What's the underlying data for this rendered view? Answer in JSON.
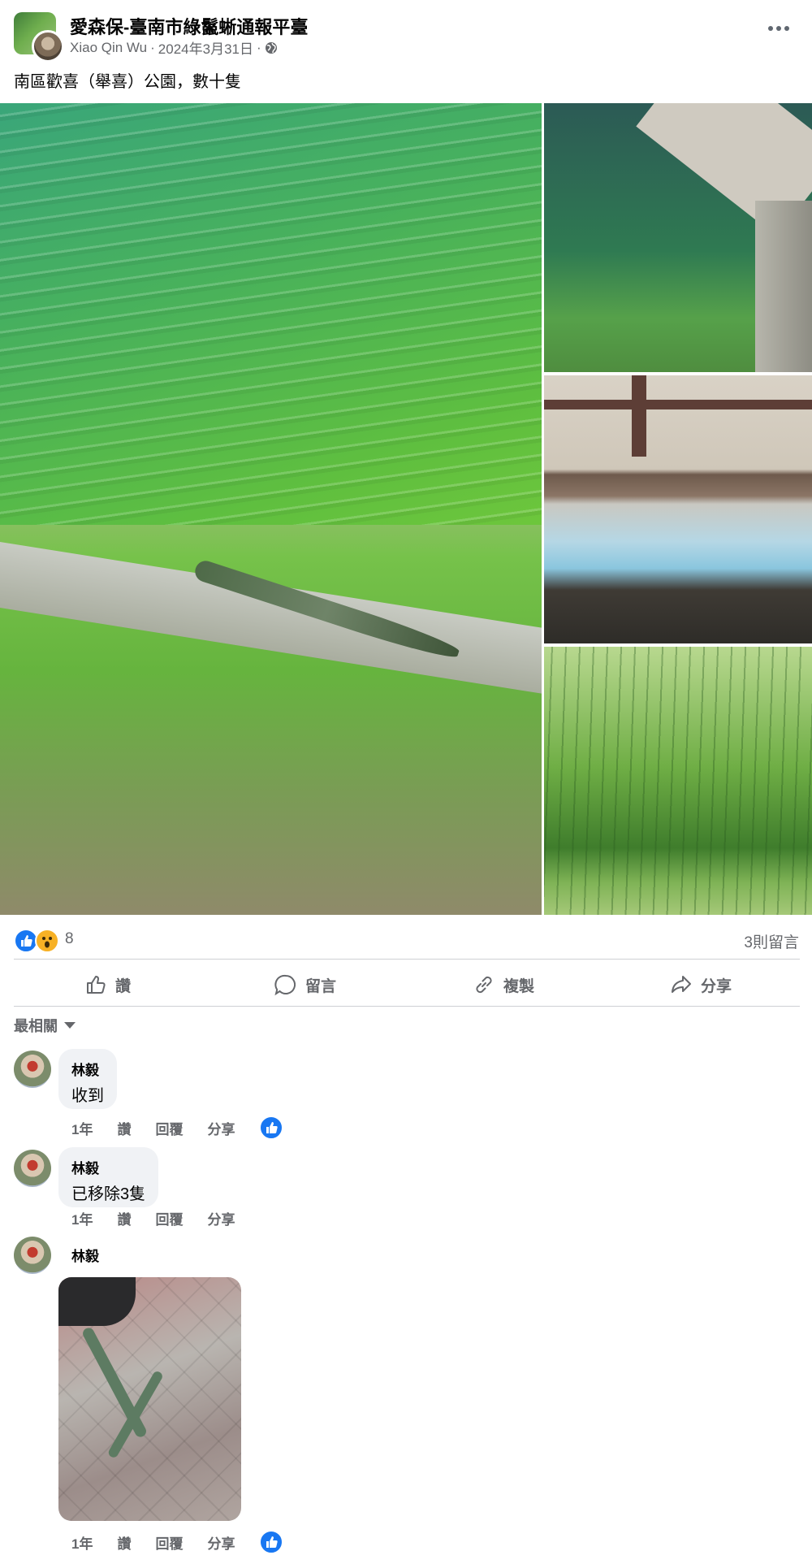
{
  "post": {
    "group_name": "愛森保-臺南市綠鬣蜥通報平臺",
    "author": "Xiao Qin Wu",
    "separator": "·",
    "date": "2024年3月31日",
    "audience_icon": "globe-icon",
    "text": "南區歡喜（舉喜）公園，數十隻"
  },
  "reactions": {
    "icons": [
      "like-icon",
      "wow-icon"
    ],
    "count": "8",
    "comments_count": "3則留言"
  },
  "actions": {
    "like": "讚",
    "comment": "留言",
    "copy": "複製",
    "share": "分享"
  },
  "sort": {
    "label": "最相關"
  },
  "comments": [
    {
      "name": "林毅",
      "text": "收到",
      "time": "1年",
      "like": "讚",
      "reply": "回覆",
      "share": "分享"
    },
    {
      "name": "林毅",
      "text": "已移除3隻",
      "time": "1年",
      "like": "讚",
      "reply": "回覆",
      "share": "分享"
    },
    {
      "name": "林毅",
      "text": "",
      "time": "1年",
      "like": "讚",
      "reply": "回覆",
      "share": "分享"
    }
  ],
  "colors": {
    "accent": "#1877f2",
    "secondary_text": "#65676b",
    "bubble": "#f0f2f5"
  }
}
